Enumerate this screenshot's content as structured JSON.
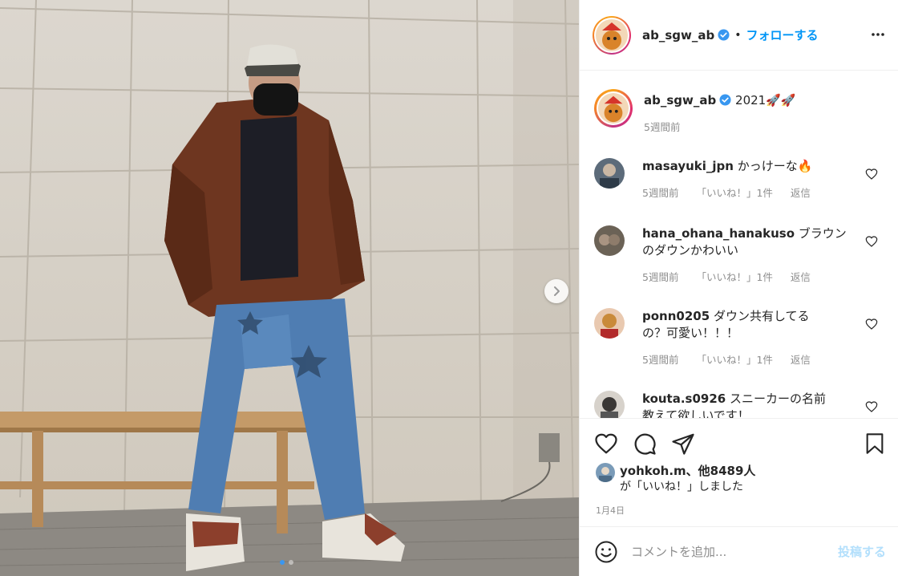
{
  "post": {
    "author": "ab_sgw_ab",
    "follow_label": "フォローする",
    "separator": "•",
    "caption": "2021🚀🚀",
    "caption_time": "5週間前"
  },
  "comments": [
    {
      "user": "masayuki_jpn",
      "text": "かっけーな🔥",
      "time": "5週間前",
      "likes": "「いいね！」1件",
      "reply": "返信"
    },
    {
      "user": "hana_ohana_hanakuso",
      "text": "ブラウン",
      "text2": "のダウンかわいい",
      "time": "5週間前",
      "likes": "「いいね！」1件",
      "reply": "返信"
    },
    {
      "user": "ponn0205",
      "text": "ダウン共有してる",
      "text2": "の？可愛い！！！",
      "time": "5週間前",
      "likes": "「いいね！」1件",
      "reply": "返信"
    },
    {
      "user": "kouta.s0926",
      "text": "スニーカーの名前",
      "text2": "教えて欲しいです！"
    }
  ],
  "likes": {
    "line1": "yohkoh.m、他8489人",
    "line2": "が「いいね！」しました"
  },
  "date": "1月4日",
  "comment_box": {
    "placeholder": "コメントを追加...",
    "post_label": "投稿する"
  },
  "carousel": {
    "slides": 2,
    "active": 1
  },
  "icons": [
    "verified-icon",
    "more-icon",
    "heart-icon",
    "comment-icon",
    "share-icon",
    "bookmark-icon",
    "emoji-icon",
    "chevron-right-icon"
  ],
  "colors": {
    "accent": "#0095f6",
    "post_disabled": "#b2dffc",
    "meta": "#8e8e8e",
    "verified": "#3897f0"
  }
}
